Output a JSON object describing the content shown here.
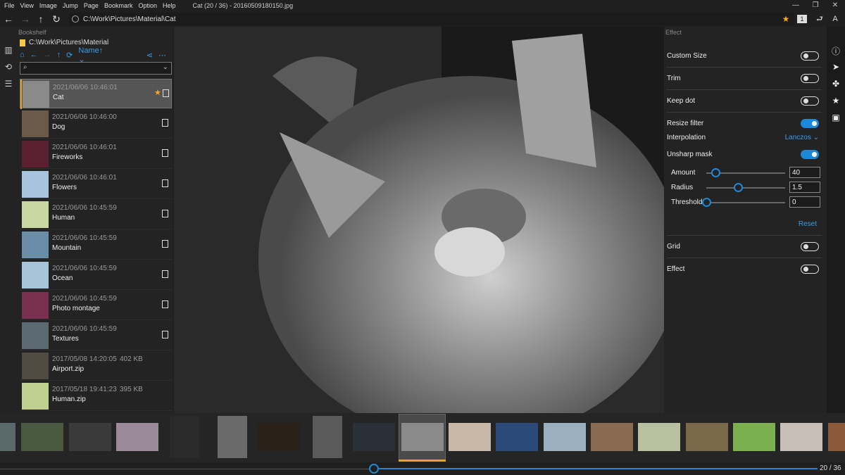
{
  "menu": [
    "File",
    "View",
    "Image",
    "Jump",
    "Page",
    "Bookmark",
    "Option",
    "Help"
  ],
  "window_title": "Cat (20 / 36) - 20160509180150.jpg",
  "window_controls": [
    "—",
    "❐",
    "✕"
  ],
  "address": "C:\\Work\\Pictures\\Material\\Cat",
  "address_right_icons": {
    "star": "★",
    "page": "1",
    "back": "⮐",
    "font": "A"
  },
  "bookshelf": {
    "title": "Bookshelf",
    "path": "C:\\Work\\Pictures\\Material",
    "sort_label": "Name↑",
    "items": [
      {
        "date": "2021/06/06 10:46:01",
        "name": "Cat",
        "size": "",
        "color": "#8a8a8a",
        "selected": true,
        "starred": true,
        "checkbox": true
      },
      {
        "date": "2021/06/06 10:46:00",
        "name": "Dog",
        "size": "",
        "color": "#6b5a4a",
        "selected": false,
        "starred": false,
        "checkbox": true
      },
      {
        "date": "2021/06/06 10:46:01",
        "name": "Fireworks",
        "size": "",
        "color": "#5a2030",
        "selected": false,
        "starred": false,
        "checkbox": true
      },
      {
        "date": "2021/06/06 10:46:01",
        "name": "Flowers",
        "size": "",
        "color": "#a7c4de",
        "selected": false,
        "starred": false,
        "checkbox": true
      },
      {
        "date": "2021/06/06 10:45:59",
        "name": "Human",
        "size": "",
        "color": "#c8d8a0",
        "selected": false,
        "starred": false,
        "checkbox": true
      },
      {
        "date": "2021/06/06 10:45:59",
        "name": "Mountain",
        "size": "",
        "color": "#6b8ea8",
        "selected": false,
        "starred": false,
        "checkbox": true
      },
      {
        "date": "2021/06/06 10:45:59",
        "name": "Ocean",
        "size": "",
        "color": "#a8c4d8",
        "selected": false,
        "starred": false,
        "checkbox": true
      },
      {
        "date": "2021/06/06 10:45:59",
        "name": "Photo montage",
        "size": "",
        "color": "#7a3050",
        "selected": false,
        "starred": false,
        "checkbox": true
      },
      {
        "date": "2021/06/06 10:45:59",
        "name": "Textures",
        "size": "",
        "color": "#5a6a70",
        "selected": false,
        "starred": false,
        "checkbox": true
      },
      {
        "date": "2017/05/08 14:20:05",
        "name": "Airport.zip",
        "size": "402 KB",
        "color": "#504a40",
        "selected": false,
        "starred": false,
        "checkbox": false
      },
      {
        "date": "2017/05/18 19:41:23",
        "name": "Human.zip",
        "size": "395 KB",
        "color": "#c0d090",
        "selected": false,
        "starred": false,
        "checkbox": false
      }
    ]
  },
  "effect": {
    "title": "Effect",
    "custom_size": {
      "label": "Custom Size",
      "on": false
    },
    "trim": {
      "label": "Trim",
      "on": false
    },
    "keep_dot": {
      "label": "Keep dot",
      "on": false
    },
    "resize_filter": {
      "label": "Resize filter",
      "on": true
    },
    "interpolation": {
      "label": "Interpolation",
      "value": "Lanczos"
    },
    "unsharp_mask": {
      "label": "Unsharp mask",
      "on": true
    },
    "amount": {
      "label": "Amount",
      "value": "40",
      "level": 0.13
    },
    "radius": {
      "label": "Radius",
      "value": "1.5",
      "level": 0.45
    },
    "threshold": {
      "label": "Threshold",
      "value": "0",
      "level": 0.0
    },
    "reset": "Reset",
    "grid": {
      "label": "Grid",
      "on": false
    },
    "effect_toggle": {
      "label": "Effect",
      "on": false
    }
  },
  "filmstrip": {
    "colors": [
      "#5a6a6a",
      "#4a5a40",
      "#3a3a3a",
      "#9a8a9a",
      "#2a2a2a",
      "#6a6a6a",
      "#2a2218",
      "#5a5a5a",
      "#2a3038",
      "#8a8a8a",
      "#c8b8a8",
      "#2a4a7a",
      "#9ab0c0",
      "#8a6a50",
      "#b8c0a0",
      "#7a6a4a",
      "#7ab050",
      "#c8c0b8",
      "#8a5a3a"
    ]
  },
  "page": {
    "current": 20,
    "total": 36,
    "label": "20 / 36",
    "position": 0.543
  }
}
